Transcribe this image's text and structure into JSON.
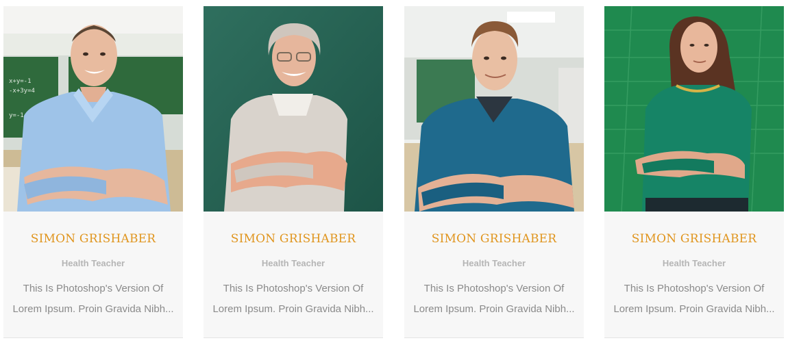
{
  "theme": {
    "name_color": "#e0951e",
    "role_color": "#b5b5b5",
    "text_color": "#8a8a8a",
    "card_bg": "#f7f7f7"
  },
  "team": [
    {
      "name": "SIMON GRISHABER",
      "role": "Health Teacher",
      "bio_line1": "This Is Photoshop's Version Of",
      "bio_line2": "Lorem Ipsum. Proin Gravida Nibh...",
      "photo": "male-teacher-blue-shirt-classroom-photo"
    },
    {
      "name": "SIMON GRISHABER",
      "role": "Health Teacher",
      "bio_line1": "This Is Photoshop's Version Of",
      "bio_line2": "Lorem Ipsum. Proin Gravida Nibh...",
      "photo": "senior-female-teacher-chalkboard-photo"
    },
    {
      "name": "SIMON GRISHABER",
      "role": "Health Teacher",
      "bio_line1": "This Is Photoshop's Version Of",
      "bio_line2": "Lorem Ipsum. Proin Gravida Nibh...",
      "photo": "male-teacher-blue-sweater-photo"
    },
    {
      "name": "SIMON GRISHABER",
      "role": "Health Teacher",
      "bio_line1": "This Is Photoshop's Version Of",
      "bio_line2": "Lorem Ipsum. Proin Gravida Nibh...",
      "photo": "female-teacher-green-sweater-photo"
    }
  ]
}
